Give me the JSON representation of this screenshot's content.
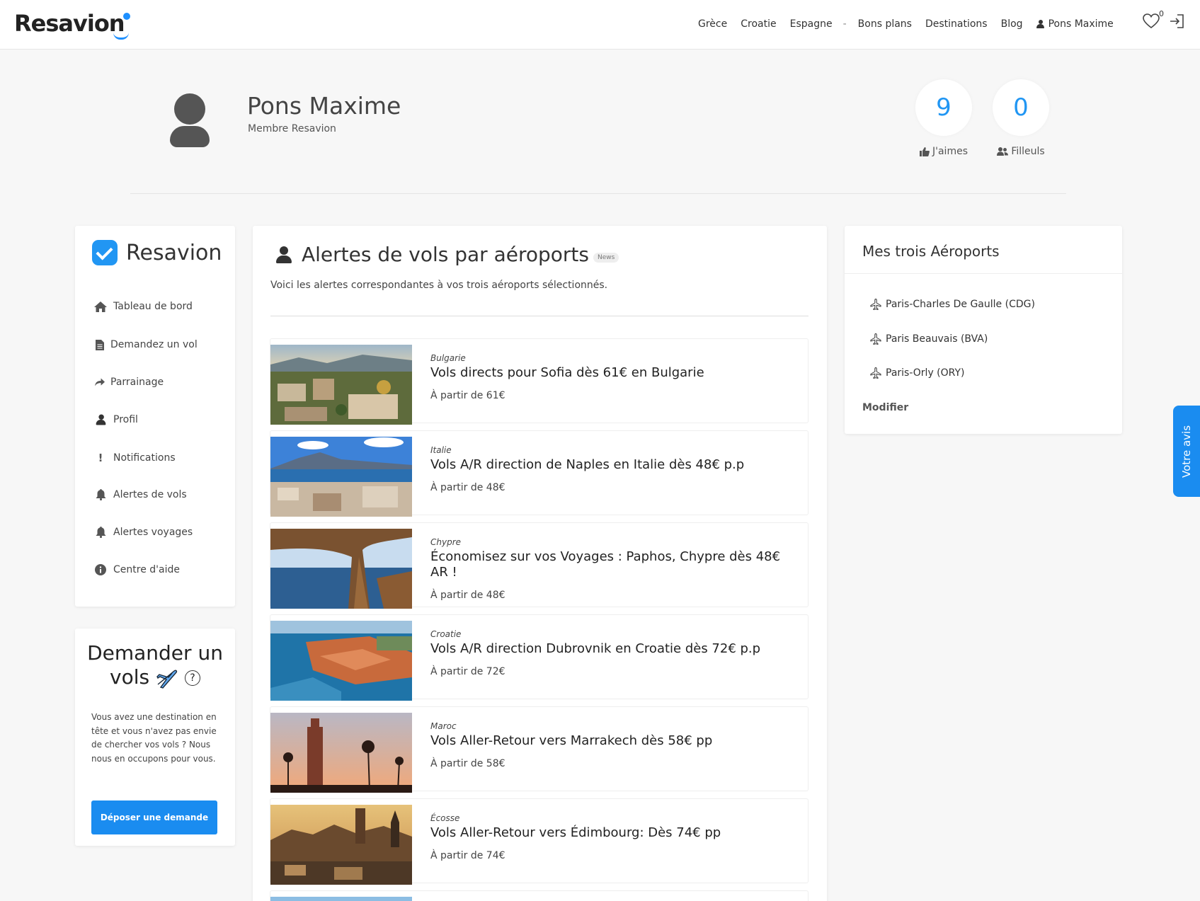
{
  "header": {
    "logo": "Resavion",
    "nav": [
      "Grèce",
      "Croatie",
      "Espagne",
      "-",
      "Bons plans",
      "Destinations",
      "Blog"
    ],
    "user": "Pons Maxime",
    "wishlist_count": "0"
  },
  "profile": {
    "name": "Pons Maxime",
    "subtitle": "Membre Resavion",
    "likes": {
      "value": "9",
      "label": "J'aimes"
    },
    "referrals": {
      "value": "0",
      "label": "Filleuls"
    }
  },
  "sidebar": {
    "brand": "Resavion",
    "items": [
      {
        "label": "Tableau de bord",
        "icon": "home-icon"
      },
      {
        "label": "Demandez un vol",
        "icon": "document-icon"
      },
      {
        "label": "Parrainage",
        "icon": "share-icon"
      },
      {
        "label": "Profil",
        "icon": "user-icon"
      },
      {
        "label": "Notifications",
        "icon": "exclamation-icon"
      },
      {
        "label": "Alertes de vols",
        "icon": "bell-icon"
      },
      {
        "label": "Alertes voyages",
        "icon": "bell-icon"
      },
      {
        "label": "Centre d'aide",
        "icon": "info-icon"
      }
    ]
  },
  "request": {
    "title_line1": "Demander un",
    "title_line2": "vols",
    "text": "Vous avez une destination en tête et vous n'avez pas envie de chercher vos vols ? Nous nous en occupons pour vous.",
    "button": "Déposer une demande"
  },
  "main": {
    "title": "Alertes de vols par aéroports",
    "badge": "News",
    "subtitle": "Voici les alertes correspondantes à vos trois aéroports sélectionnés.",
    "deals": [
      {
        "country": "Bulgarie",
        "title": "Vols directs pour Sofia dès 61€ en Bulgarie",
        "price": "À partir de 61€"
      },
      {
        "country": "Italie",
        "title": "Vols A/R direction de Naples en Italie dès 48€ p.p",
        "price": "À partir de 48€"
      },
      {
        "country": "Chypre",
        "title": "Économisez sur vos Voyages : Paphos, Chypre dès 48€ AR !",
        "price": "À partir de 48€"
      },
      {
        "country": "Croatie",
        "title": "Vols A/R direction Dubrovnik en Croatie dès 72€ p.p",
        "price": "À partir de 72€"
      },
      {
        "country": "Maroc",
        "title": "Vols Aller-Retour vers Marrakech dès 58€ pp",
        "price": "À partir de 58€"
      },
      {
        "country": "Écosse",
        "title": "Vols Aller-Retour vers Édimbourg: Dès 74€ pp",
        "price": "À partir de 74€"
      }
    ]
  },
  "airports": {
    "title": "Mes trois Aéroports",
    "items": [
      "Paris-Charles De Gaulle (CDG)",
      "Paris Beauvais (BVA)",
      "Paris-Orly (ORY)"
    ],
    "modify": "Modifier"
  },
  "feedback_tab": "Votre avis",
  "colors": {
    "accent": "#1a8cf0",
    "counter": "#2196f3"
  }
}
